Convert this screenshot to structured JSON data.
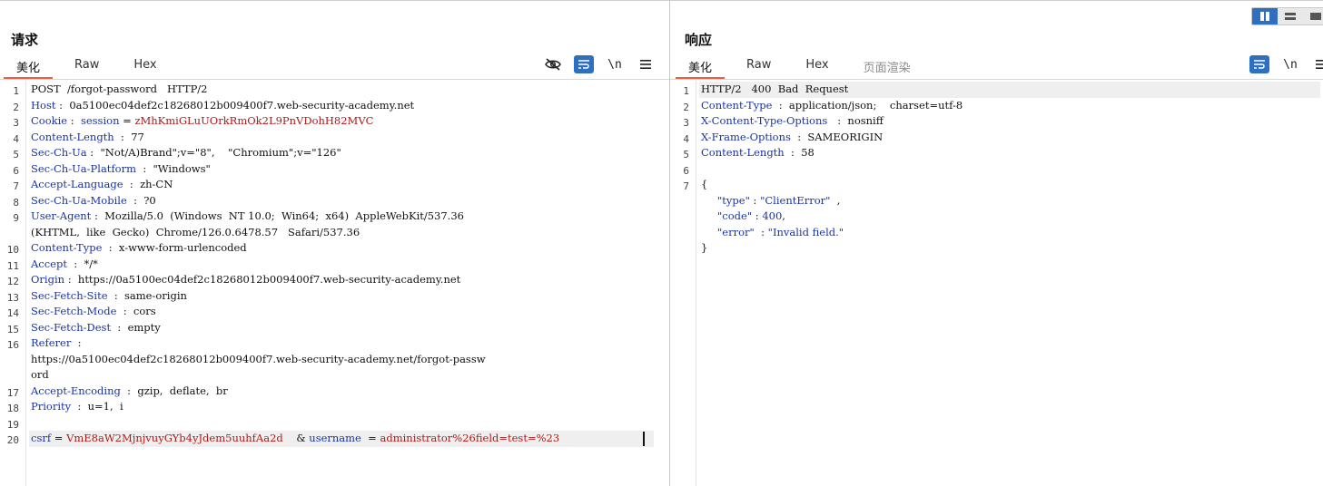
{
  "request": {
    "title": "请求",
    "tabs": [
      "美化",
      "Raw",
      "Hex"
    ],
    "newline_label": "\\n",
    "line_numbers": [
      "1",
      "2",
      "3",
      "4",
      "5",
      "6",
      "7",
      "8",
      "9",
      "10",
      "11",
      "12",
      "13",
      "14",
      "15",
      "16",
      "17",
      "18",
      "19",
      "20"
    ],
    "lines": [
      {
        "plain": "POST  /forgot-password   HTTP/2"
      },
      {
        "key": "Host",
        "sep": " :  ",
        "val": "0a5100ec04def2c18268012b009400f7.web-security-academy.net"
      },
      {
        "key": "Cookie",
        "sep": " :  ",
        "cookie_name": "session",
        "eq": " = ",
        "cookie_val": "zMhKmiGLuUOrkRmOk2L9PnVDohH82MVC"
      },
      {
        "key": "Content-Length",
        "sep": "  :  ",
        "val": "77"
      },
      {
        "key": "Sec-Ch-Ua",
        "sep": " :  ",
        "val": "\"Not/A)Brand\";v=\"8\",    \"Chromium\";v=\"126\""
      },
      {
        "key": "Sec-Ch-Ua-Platform",
        "sep": "  :  ",
        "val": "\"Windows\""
      },
      {
        "key": "Accept-Language",
        "sep": "  :  ",
        "val": "zh-CN"
      },
      {
        "key": "Sec-Ch-Ua-Mobile",
        "sep": "  :  ",
        "val": "?0"
      },
      {
        "key": "User-Agent",
        "sep": " :  ",
        "val": "Mozilla/5.0  (Windows  NT 10.0;  Win64;  x64)  AppleWebKit/537.36"
      },
      {
        "cont": "(KHTML,  like  Gecko)  Chrome/126.0.6478.57   Safari/537.36"
      },
      {
        "key": "Content-Type",
        "sep": "  :  ",
        "val": "x-www-form-urlencoded"
      },
      {
        "key": "Accept",
        "sep": "  :  ",
        "val": "*/*"
      },
      {
        "key": "Origin",
        "sep": " :  ",
        "val": "https://0a5100ec04def2c18268012b009400f7.web-security-academy.net"
      },
      {
        "key": "Sec-Fetch-Site",
        "sep": "  :  ",
        "val": "same-origin"
      },
      {
        "key": "Sec-Fetch-Mode",
        "sep": "  :  ",
        "val": "cors"
      },
      {
        "key": "Sec-Fetch-Dest",
        "sep": "  :  ",
        "val": "empty"
      },
      {
        "key": "Referer",
        "sep": "  :",
        "val": ""
      },
      {
        "cont": "https://0a5100ec04def2c18268012b009400f7.web-security-academy.net/forgot-passw"
      },
      {
        "cont": "ord"
      },
      {
        "key": "Accept-Encoding",
        "sep": "  :  ",
        "val": "gzip,  deflate,  br"
      },
      {
        "key": "Priority",
        "sep": "  :  ",
        "val": "u=1,  i"
      },
      {
        "plain": ""
      },
      {
        "body": true,
        "p1": "csrf",
        "e1": " = ",
        "v1": "VmE8aW2MjnjvuyGYb4yJdem5uuhfAa2d",
        "amp": "    & ",
        "p2": "username",
        "e2": "  = ",
        "v2": "administrator%26field=test=%23"
      }
    ]
  },
  "response": {
    "title": "响应",
    "tabs": [
      "美化",
      "Raw",
      "Hex",
      "页面渲染"
    ],
    "newline_label": "\\n",
    "line_numbers": [
      "1",
      "2",
      "3",
      "4",
      "5",
      "6",
      "7"
    ],
    "lines": [
      {
        "plain": "HTTP/2   400  Bad  Request"
      },
      {
        "key": "Content-Type",
        "sep": "  :  ",
        "val": "application/json;    charset=utf-8"
      },
      {
        "key": "X-Content-Type-Options",
        "sep": "   :  ",
        "val": "nosniff"
      },
      {
        "key": "X-Frame-Options",
        "sep": "  :  ",
        "val": "SAMEORIGIN"
      },
      {
        "key": "Content-Length",
        "sep": "  :  ",
        "val": "58"
      },
      {
        "plain": ""
      },
      {
        "plain": "{"
      },
      {
        "json": true,
        "jk": "\"type\"",
        "jc": " : ",
        "jv": "\"ClientError\"",
        "tail": "  ,"
      },
      {
        "json": true,
        "jk": "\"code\"",
        "jc": " : ",
        "jv": "400",
        "tail": ","
      },
      {
        "json": true,
        "jk": "\"error\"",
        "jc": "  : ",
        "jv": "\"Invalid field.\"",
        "tail": ""
      },
      {
        "plain": "}"
      }
    ]
  },
  "colors": {
    "accent": "#e8603c",
    "key": "#1a33a8",
    "value": "#b01818",
    "button_blue": "#2e6fc0"
  }
}
